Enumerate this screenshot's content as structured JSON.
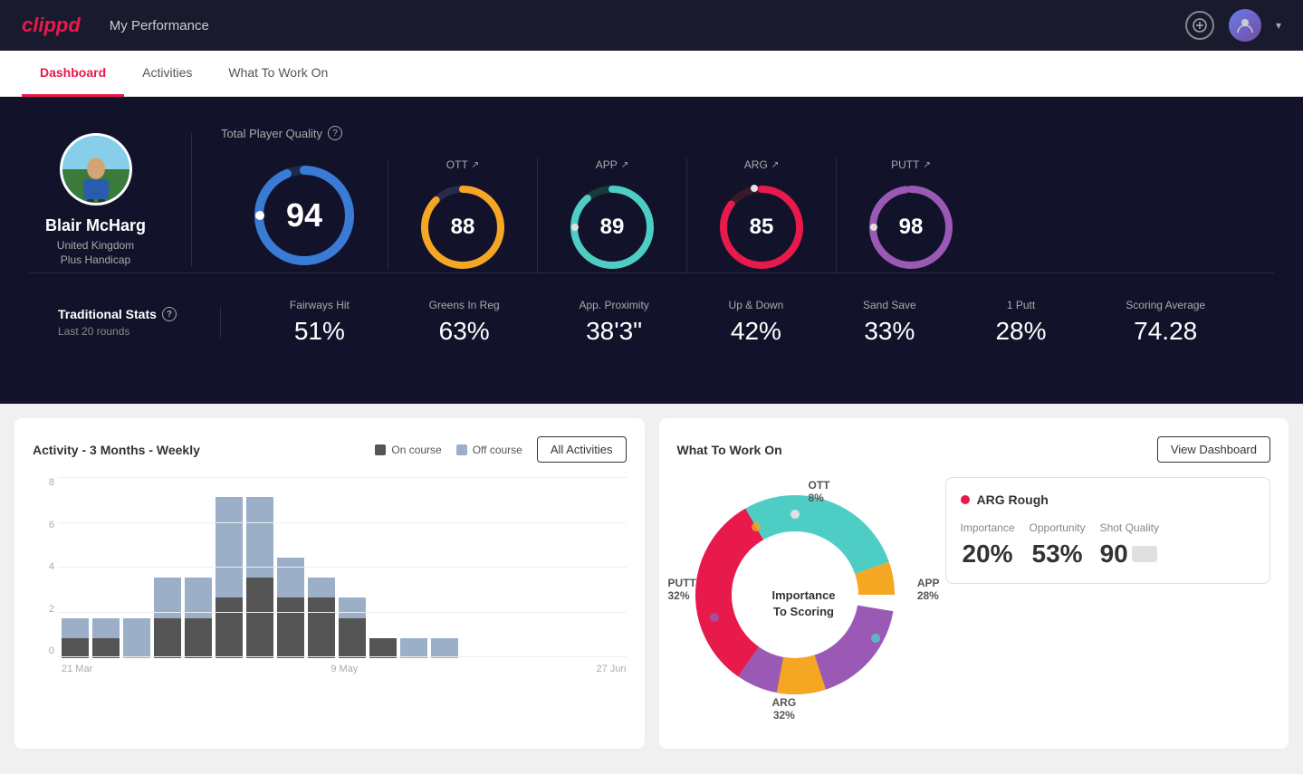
{
  "app": {
    "logo": "clippd",
    "header_title": "My Performance"
  },
  "tabs": [
    {
      "id": "dashboard",
      "label": "Dashboard",
      "active": true
    },
    {
      "id": "activities",
      "label": "Activities",
      "active": false
    },
    {
      "id": "what-to-work-on",
      "label": "What To Work On",
      "active": false
    }
  ],
  "player": {
    "name": "Blair McHarg",
    "country": "United Kingdom",
    "handicap": "Plus Handicap"
  },
  "total_quality": {
    "label": "Total Player Quality",
    "score": 94,
    "score_color": "#3a7bd5",
    "categories": [
      {
        "id": "ott",
        "label": "OTT",
        "score": 88,
        "color": "#f5a623",
        "pct": 88
      },
      {
        "id": "app",
        "label": "APP",
        "score": 89,
        "color": "#4ecdc4",
        "pct": 89
      },
      {
        "id": "arg",
        "label": "ARG",
        "score": 85,
        "color": "#e8194b",
        "pct": 85
      },
      {
        "id": "putt",
        "label": "PUTT",
        "score": 98,
        "color": "#9b59b6",
        "pct": 98
      }
    ]
  },
  "traditional_stats": {
    "label": "Traditional Stats",
    "sublabel": "Last 20 rounds",
    "items": [
      {
        "name": "Fairways Hit",
        "value": "51%"
      },
      {
        "name": "Greens In Reg",
        "value": "63%"
      },
      {
        "name": "App. Proximity",
        "value": "38'3\""
      },
      {
        "name": "Up & Down",
        "value": "42%"
      },
      {
        "name": "Sand Save",
        "value": "33%"
      },
      {
        "name": "1 Putt",
        "value": "28%"
      },
      {
        "name": "Scoring Average",
        "value": "74.28"
      }
    ]
  },
  "activity_chart": {
    "title": "Activity - 3 Months - Weekly",
    "legend": [
      {
        "label": "On course",
        "color": "#555"
      },
      {
        "label": "Off course",
        "color": "#9bb0c8"
      }
    ],
    "all_activities_button": "All Activities",
    "y_labels": [
      "8",
      "6",
      "4",
      "2",
      "0"
    ],
    "x_labels": [
      "21 Mar",
      "9 May",
      "27 Jun"
    ],
    "bars": [
      {
        "oncourse": 1,
        "offcourse": 1
      },
      {
        "oncourse": 1,
        "offcourse": 1
      },
      {
        "oncourse": 0,
        "offcourse": 2
      },
      {
        "oncourse": 2,
        "offcourse": 2
      },
      {
        "oncourse": 2,
        "offcourse": 2
      },
      {
        "oncourse": 3,
        "offcourse": 5
      },
      {
        "oncourse": 4,
        "offcourse": 4
      },
      {
        "oncourse": 3,
        "offcourse": 2
      },
      {
        "oncourse": 3,
        "offcourse": 1
      },
      {
        "oncourse": 2,
        "offcourse": 1
      },
      {
        "oncourse": 1,
        "offcourse": 0
      },
      {
        "oncourse": 0,
        "offcourse": 1
      },
      {
        "oncourse": 0,
        "offcourse": 1
      }
    ]
  },
  "what_to_work_on": {
    "title": "What To Work On",
    "view_dashboard_button": "View Dashboard",
    "donut": {
      "center_line1": "Importance",
      "center_line2": "To Scoring",
      "segments": [
        {
          "label": "OTT",
          "value": "8%",
          "color": "#f5a623",
          "pct": 8
        },
        {
          "label": "APP",
          "value": "28%",
          "color": "#4ecdc4",
          "pct": 28
        },
        {
          "label": "ARG",
          "value": "32%",
          "color": "#e8194b",
          "pct": 32
        },
        {
          "label": "PUTT",
          "value": "32%",
          "color": "#9b59b6",
          "pct": 32
        }
      ]
    },
    "recommendation": {
      "title": "ARG Rough",
      "dot_color": "#e8194b",
      "metrics": [
        {
          "name": "Importance",
          "value": "20%"
        },
        {
          "name": "Opportunity",
          "value": "53%"
        },
        {
          "name": "Shot Quality",
          "value": "90"
        }
      ]
    }
  }
}
